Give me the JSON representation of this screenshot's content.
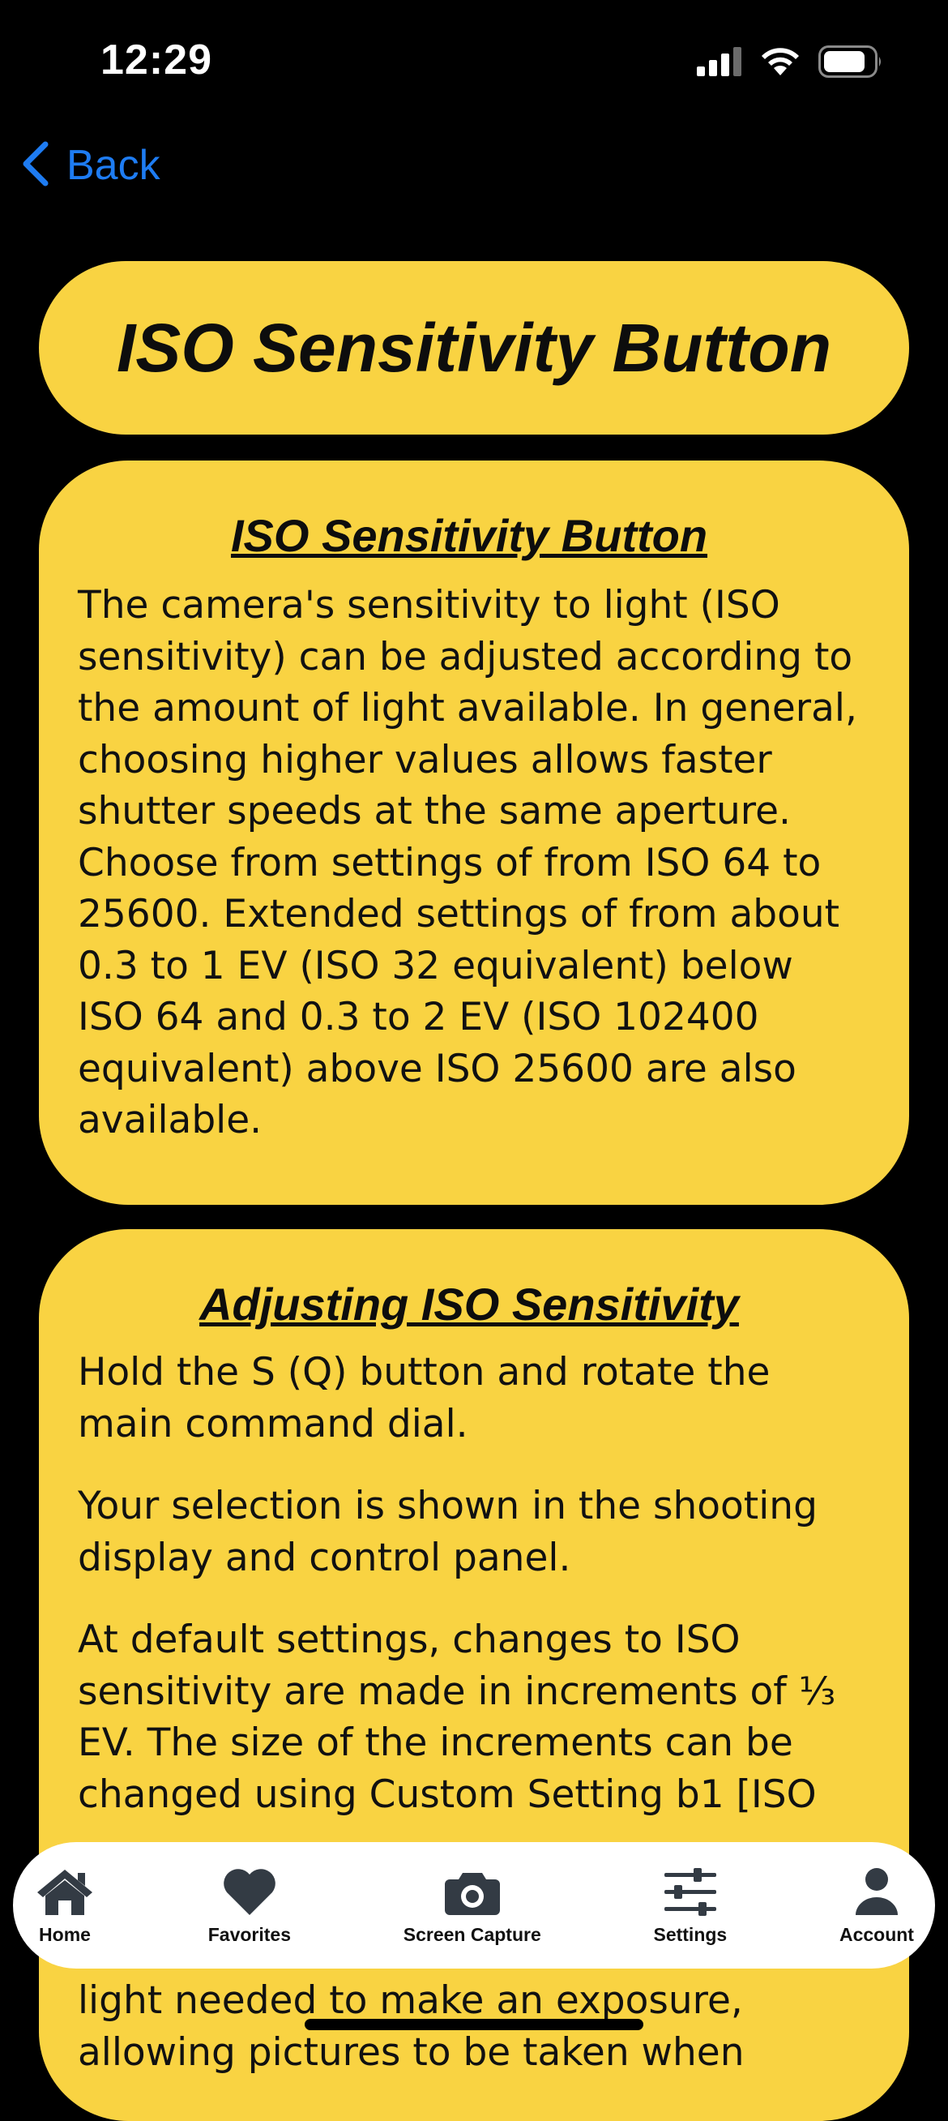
{
  "status_bar": {
    "time": "12:29",
    "icons": [
      "signal-icon",
      "wifi-icon",
      "battery-icon"
    ]
  },
  "nav": {
    "back_label": "Back",
    "accent_color": "#1e7cf2"
  },
  "page_title": "ISO Sensitivity Button",
  "theme": {
    "card_color": "#f9d342",
    "background_color": "#000000"
  },
  "cards": [
    {
      "heading": "ISO Sensitivity Button",
      "paragraphs": [
        "The camera's sensitivity to light (ISO sensitivity) can be adjusted according to the amount of light available. In general, choosing higher values allows faster shutter speeds at the same aperture. Choose from settings of from ISO 64 to 25600. Extended settings of from about 0.3 to 1 EV (ISO 32 equivalent) below ISO 64 and 0.3 to 2 EV (ISO 102400 equivalent) above ISO 25600 are also available."
      ]
    },
    {
      "heading": "Adjusting ISO Sensitivity",
      "paragraphs": [
        "Hold the S (Q) button and rotate the main command dial.",
        "Your selection is shown in the shooting display and control panel.",
        "At default settings, changes to ISO sensitivity are made in increments of ⅓ EV. The size of the increments can be changed using Custom Setting b1 [ISO"
      ]
    }
  ],
  "below_tab_text": "light needed to make an exposure, allowing pictures to be taken when",
  "tab_bar": {
    "tabs": [
      {
        "label": "Home",
        "icon": "home-icon"
      },
      {
        "label": "Favorites",
        "icon": "heart-icon"
      },
      {
        "label": "Screen Capture",
        "icon": "camera-icon"
      },
      {
        "label": "Settings",
        "icon": "sliders-icon"
      },
      {
        "label": "Account",
        "icon": "user-icon"
      }
    ]
  }
}
